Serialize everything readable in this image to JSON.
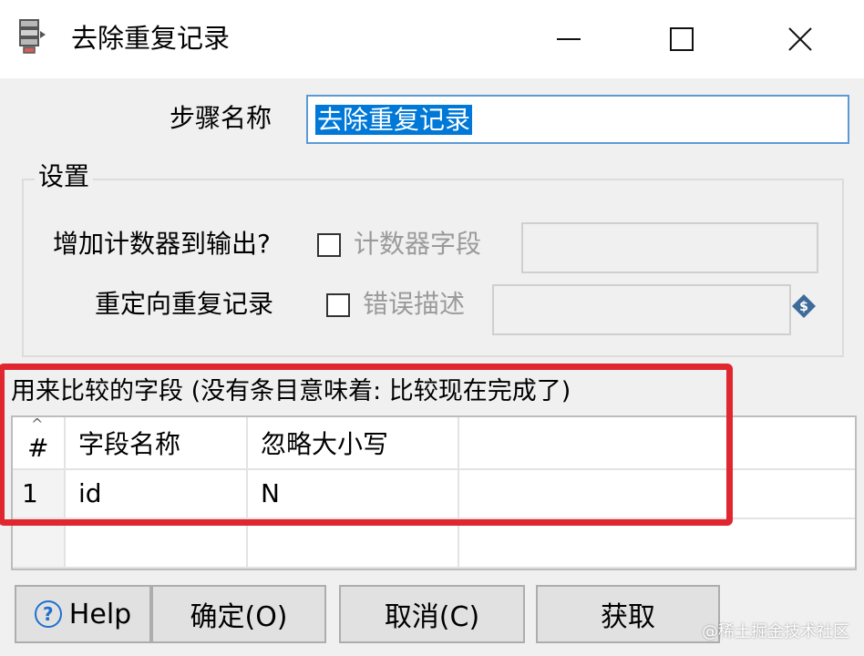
{
  "window": {
    "title": "去除重复记录",
    "icon": "dedupe-step-icon",
    "controls": [
      "minimize-icon",
      "maximize-icon",
      "close-icon"
    ]
  },
  "step": {
    "label": "步骤名称",
    "value": "去除重复记录"
  },
  "settings": {
    "title": "设置",
    "add_counter_label": "增加计数器到输出?",
    "add_counter_checked": false,
    "counter_field_label": "计数器字段",
    "counter_field_value": "",
    "redirect_label": "重定向重复记录",
    "redirect_checked": false,
    "error_desc_label": "错误描述",
    "error_desc_value": ""
  },
  "fields": {
    "title": "用来比较的字段 (没有条目意味着: 比较现在完成了)",
    "columns": [
      "#",
      "字段名称",
      "忽略大小写"
    ],
    "rows": [
      {
        "num": "1",
        "name": "id",
        "ignore_case": "N"
      }
    ]
  },
  "buttons": {
    "help": "Help",
    "ok": "确定(O)",
    "cancel": "取消(C)",
    "get": "获取"
  },
  "watermark": "@稀土掘金技术社区",
  "colors": {
    "highlight": "#e0262f",
    "selection": "#0078d7",
    "input_border": "#5b9bd5"
  }
}
